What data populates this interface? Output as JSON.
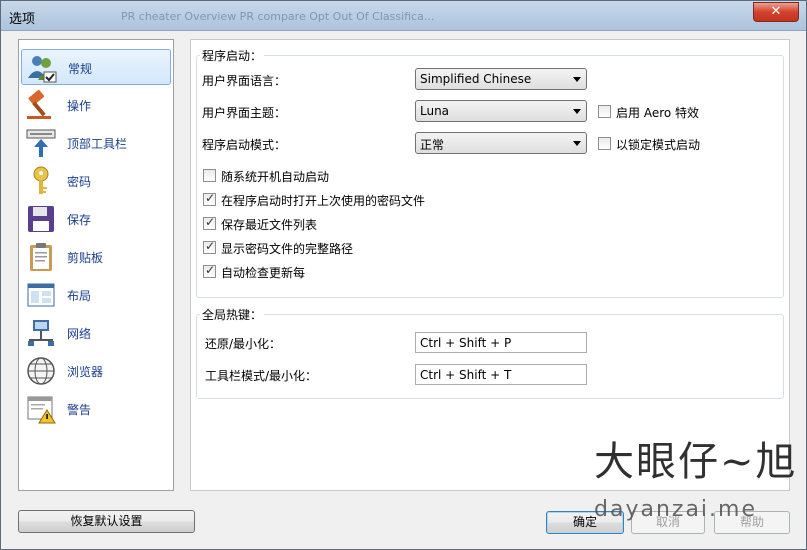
{
  "window": {
    "title": "选项",
    "faint_title": "PR cheater  Overview  PR compare  Opt Out Of Classifica..."
  },
  "sidebar": {
    "items": [
      {
        "label": "常规",
        "icon": "users-check-icon"
      },
      {
        "label": "操作",
        "icon": "gavel-icon"
      },
      {
        "label": "顶部工具栏",
        "icon": "toolbar-upload-icon"
      },
      {
        "label": "密码",
        "icon": "key-icon"
      },
      {
        "label": "保存",
        "icon": "floppy-disk-icon"
      },
      {
        "label": "剪贴板",
        "icon": "clipboard-icon"
      },
      {
        "label": "布局",
        "icon": "layout-icon"
      },
      {
        "label": "网络",
        "icon": "network-icon"
      },
      {
        "label": "浏览器",
        "icon": "globe-icon"
      },
      {
        "label": "警告",
        "icon": "warning-document-icon"
      }
    ]
  },
  "startup": {
    "group_title": "程序启动：",
    "language_label": "用户界面语言：",
    "language_value": "Simplified Chinese",
    "theme_label": "用户界面主题：",
    "theme_value": "Luna",
    "aero_label": "启用 Aero 特效",
    "mode_label": "程序启动模式：",
    "mode_value": "正常",
    "locked_label": "以锁定模式启动",
    "autostart_label": "随系统开机自动启动",
    "open_last_label": "在程序启动时打开上次使用的密码文件",
    "save_recent_label": "保存最近文件列表",
    "full_path_label": "显示密码文件的完整路径",
    "auto_update_label": "自动检查更新每"
  },
  "hotkeys": {
    "group_title": "全局热键：",
    "restore_label": "还原/最小化：",
    "restore_value": "Ctrl + Shift + P",
    "toolbar_label": "工具栏模式/最小化：",
    "toolbar_value": "Ctrl + Shift + T"
  },
  "buttons": {
    "reset": "恢复默认设置",
    "ok": "确定",
    "cancel": "取消",
    "help": "帮助"
  },
  "watermark": {
    "cn": "大眼仔~旭",
    "url": "dayanzai.me"
  }
}
